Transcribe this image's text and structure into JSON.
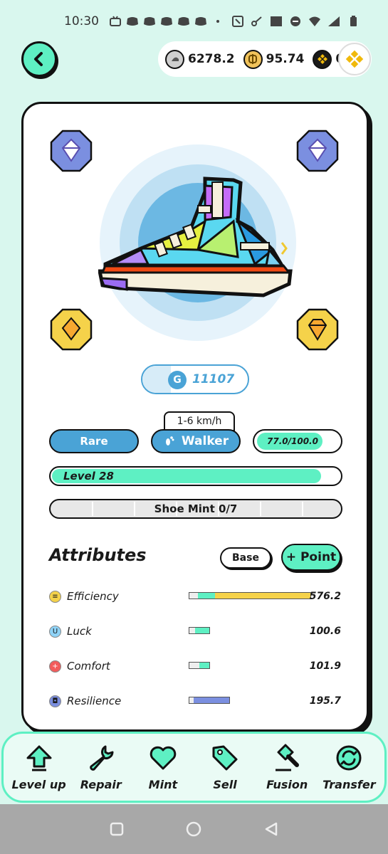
{
  "status_bar": {
    "time": "10:30"
  },
  "balances": [
    {
      "name": "GST",
      "icon": "gst-coin-icon",
      "value": "6278.2"
    },
    {
      "name": "GMT",
      "icon": "gmt-coin-icon",
      "value": "95.74"
    },
    {
      "name": "BNB",
      "icon": "bnb-coin-icon",
      "value": "0"
    }
  ],
  "sneaker": {
    "gene_letter": "G",
    "gene_id": "11107",
    "speed_range": "1-6 km/h",
    "quality": "Rare",
    "type": "Walker",
    "durability": "77.0/100.0",
    "durability_fraction": 0.77,
    "level_label": "Level 28",
    "level_progress": 0.92,
    "mint_label": "Shoe Mint 0/7",
    "colors": {
      "accent": "#5ef0c3",
      "rare_blue": "#4aa3d6"
    }
  },
  "attributes": {
    "title": "Attributes",
    "base_label": "Base",
    "point_label": "+ Point",
    "items": [
      {
        "name": "Efficiency",
        "value": "576.2",
        "icon": "efficiency-icon",
        "color": "#f5d24a"
      },
      {
        "name": "Luck",
        "value": "100.6",
        "icon": "luck-icon",
        "color": "#8fd3f7"
      },
      {
        "name": "Comfort",
        "value": "101.9",
        "icon": "comfort-icon",
        "color": "#f25c5c"
      },
      {
        "name": "Resilience",
        "value": "195.7",
        "icon": "resilience-icon",
        "color": "#7b8fe0"
      }
    ]
  },
  "actions": [
    {
      "label": "Level up",
      "icon": "level-up-icon"
    },
    {
      "label": "Repair",
      "icon": "wrench-icon"
    },
    {
      "label": "Mint",
      "icon": "heart-icon"
    },
    {
      "label": "Sell",
      "icon": "price-tag-icon"
    },
    {
      "label": "Fusion",
      "icon": "hammer-icon"
    },
    {
      "label": "Transfer",
      "icon": "transfer-icon"
    }
  ]
}
